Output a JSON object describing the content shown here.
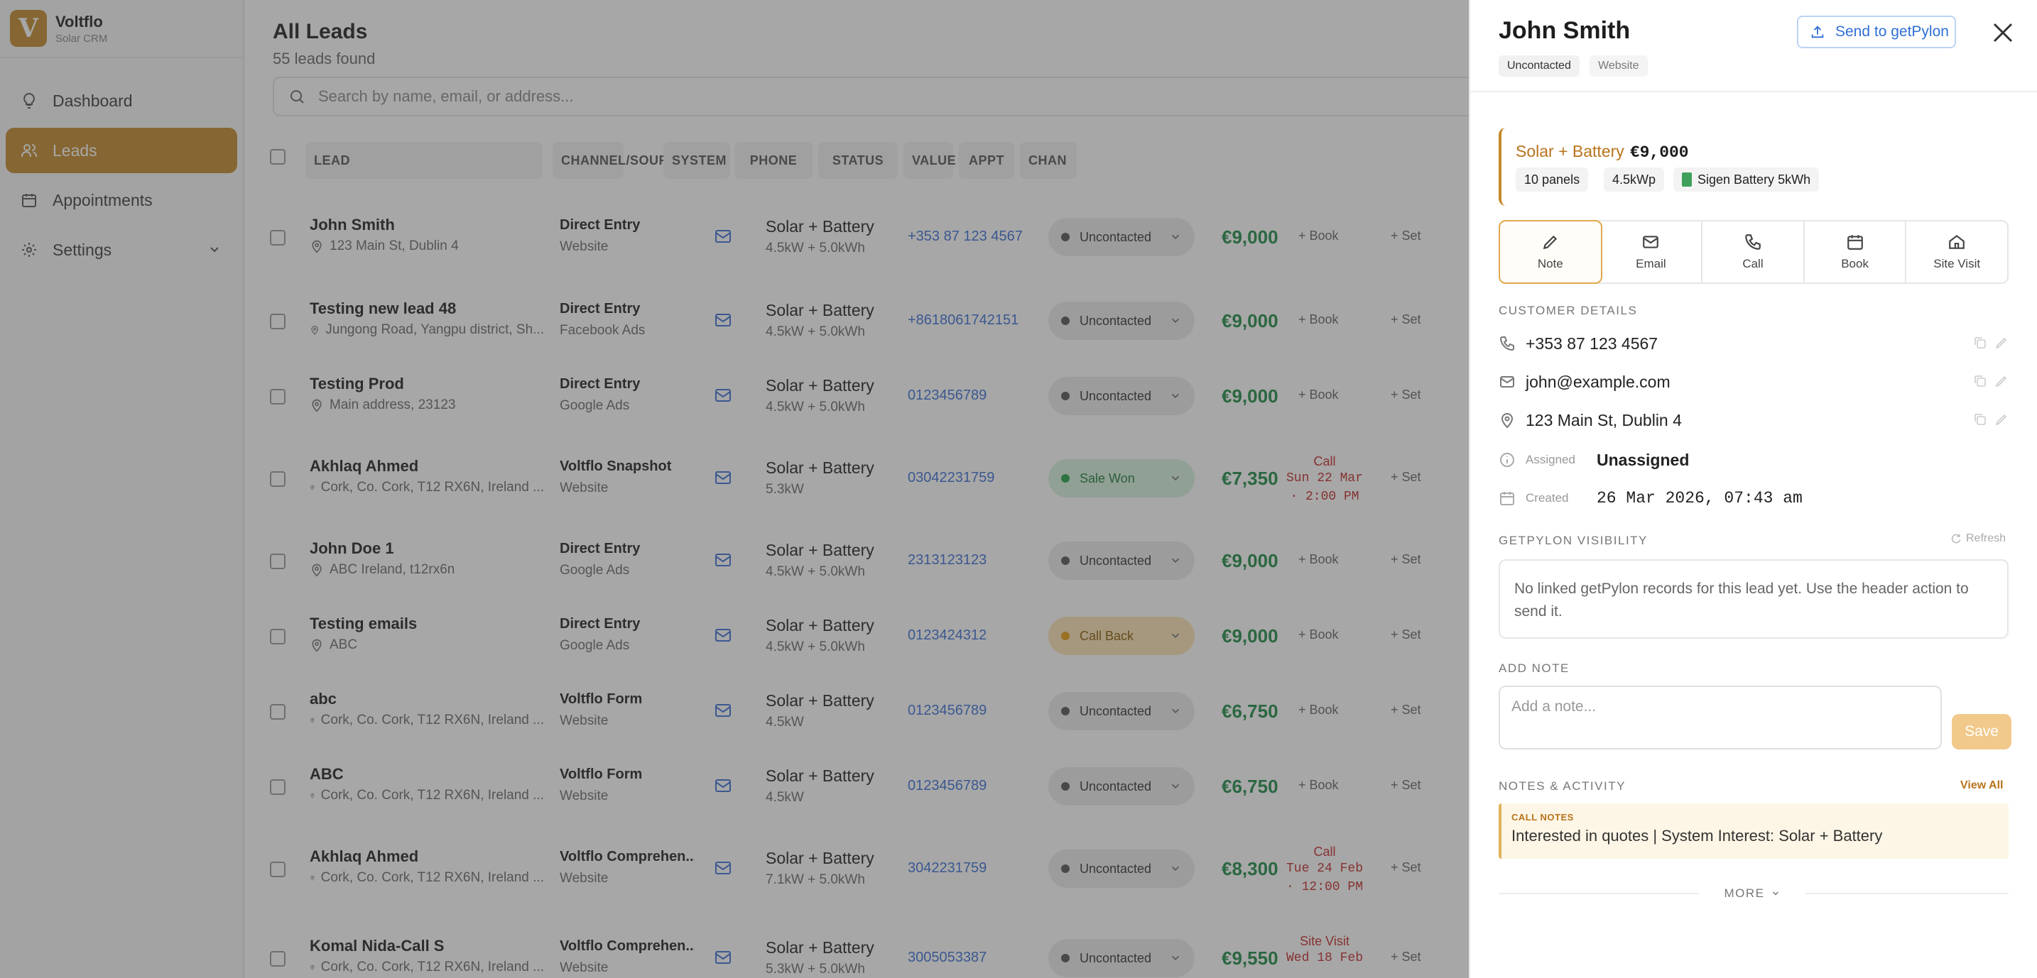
{
  "brand": {
    "logo_letter": "V",
    "name": "Voltflo",
    "subtitle": "Solar CRM",
    "accent": "#c4892b"
  },
  "nav": [
    {
      "label": "Dashboard",
      "icon": "lightbulb-icon",
      "active": false
    },
    {
      "label": "Leads",
      "icon": "users-icon",
      "active": true
    },
    {
      "label": "Appointments",
      "icon": "calendar-icon",
      "active": false
    },
    {
      "label": "Settings",
      "icon": "gear-icon",
      "active": false
    }
  ],
  "main": {
    "title": "All Leads",
    "count_text": "55 leads found",
    "search_placeholder": "Search by name, email, or address...",
    "columns": [
      "LEAD",
      "CHANNEL/SOURCE",
      "SYSTEM",
      "PHONE",
      "STATUS",
      "VALUE",
      "APPT",
      "CHAN"
    ],
    "book_label": "+ Book",
    "set_label": "+ Set"
  },
  "leads": [
    {
      "name": "John Smith",
      "address": "123 Main St, Dublin 4",
      "channel": "Direct Entry",
      "source": "Website",
      "system": "Solar + Battery",
      "system_spec": "4.5kW + 5.0kWh",
      "phone": "+353 87 123 4567",
      "status": "Uncontacted",
      "value": "€9,000",
      "appt": null
    },
    {
      "name": "Testing new lead 48",
      "address": "Jungong Road, Yangpu district, Sh...",
      "channel": "Direct Entry",
      "source": "Facebook Ads",
      "system": "Solar + Battery",
      "system_spec": "4.5kW + 5.0kWh",
      "phone": "+8618061742151",
      "status": "Uncontacted",
      "value": "€9,000",
      "appt": null
    },
    {
      "name": "Testing Prod",
      "address": "Main address, 23123",
      "channel": "Direct Entry",
      "source": "Google Ads",
      "system": "Solar + Battery",
      "system_spec": "4.5kW + 5.0kWh",
      "phone": "0123456789",
      "status": "Uncontacted",
      "value": "€9,000",
      "appt": null
    },
    {
      "name": "Akhlaq Ahmed",
      "address": "Cork, Co. Cork, T12 RX6N, Ireland ...",
      "channel": "Voltflo Snapshot",
      "source": "Website",
      "system": "Solar + Battery",
      "system_spec": "5.3kW",
      "phone": "03042231759",
      "status": "Sale Won",
      "value": "€7,350",
      "appt": {
        "type": "Call",
        "line1": "Sun 22 Mar",
        "line2": "· 2:00 PM"
      }
    },
    {
      "name": "John Doe 1",
      "address": "ABC Ireland, t12rx6n",
      "channel": "Direct Entry",
      "source": "Google Ads",
      "system": "Solar + Battery",
      "system_spec": "4.5kW + 5.0kWh",
      "phone": "2313123123",
      "status": "Uncontacted",
      "value": "€9,000",
      "appt": null
    },
    {
      "name": "Testing emails",
      "address": "ABC",
      "channel": "Direct Entry",
      "source": "Google Ads",
      "system": "Solar + Battery",
      "system_spec": "4.5kW + 5.0kWh",
      "phone": "0123424312",
      "status": "Call Back",
      "value": "€9,000",
      "appt": null
    },
    {
      "name": "abc",
      "address": "Cork, Co. Cork, T12 RX6N, Ireland ...",
      "channel": "Voltflo Form",
      "source": "Website",
      "system": "Solar + Battery",
      "system_spec": "4.5kW",
      "phone": "0123456789",
      "status": "Uncontacted",
      "value": "€6,750",
      "appt": null
    },
    {
      "name": "ABC",
      "address": "Cork, Co. Cork, T12 RX6N, Ireland ...",
      "channel": "Voltflo Form",
      "source": "Website",
      "system": "Solar + Battery",
      "system_spec": "4.5kW",
      "phone": "0123456789",
      "status": "Uncontacted",
      "value": "€6,750",
      "appt": null
    },
    {
      "name": "Akhlaq Ahmed",
      "address": "Cork, Co. Cork, T12 RX6N, Ireland ...",
      "channel": "Voltflo Comprehen...",
      "source": "Website",
      "system": "Solar + Battery",
      "system_spec": "7.1kW + 5.0kWh",
      "phone": "3042231759",
      "status": "Uncontacted",
      "value": "€8,300",
      "appt": {
        "type": "Call",
        "line1": "Tue 24 Feb",
        "line2": "· 12:00 PM"
      }
    },
    {
      "name": "Komal Nida-Call S",
      "address": "Cork, Co. Cork, T12 RX6N, Ireland ...",
      "channel": "Voltflo Comprehen...",
      "source": "Website",
      "system": "Solar + Battery",
      "system_spec": "5.3kW + 5.0kWh",
      "phone": "3005053387",
      "status": "Uncontacted",
      "value": "€9,550",
      "appt": {
        "type": "Site Visit",
        "line1": "Wed 18 Feb",
        "line2": ""
      }
    }
  ],
  "drawer": {
    "name": "John Smith",
    "tags": [
      "Uncontacted",
      "Website"
    ],
    "send_label": "Send to getPylon",
    "quote": {
      "title": "Solar + Battery",
      "price": "€9,000",
      "chips": [
        "10 panels",
        "4.5kWp",
        "Sigen Battery 5kWh"
      ]
    },
    "actions": [
      {
        "label": "Note",
        "icon": "pencil-icon"
      },
      {
        "label": "Email",
        "icon": "mail-icon"
      },
      {
        "label": "Call",
        "icon": "phone-icon"
      },
      {
        "label": "Book",
        "icon": "calendar-icon"
      },
      {
        "label": "Site Visit",
        "icon": "home-icon"
      }
    ],
    "customer_details_label": "CUSTOMER DETAILS",
    "phone": "+353 87 123 4567",
    "email": "john@example.com",
    "address": "123 Main St, Dublin 4",
    "assigned_label": "Assigned",
    "assigned_value": "Unassigned",
    "created_label": "Created",
    "created_value": "26 Mar 2026, 07:43 am",
    "visibility_label": "GETPYLON VISIBILITY",
    "refresh_label": "Refresh",
    "visibility_text": "No linked getPylon records for this lead yet. Use the header action to send it.",
    "add_note_label": "ADD NOTE",
    "note_placeholder": "Add a note...",
    "save_label": "Save",
    "notes_label": "NOTES & ACTIVITY",
    "view_all_label": "View All",
    "note_type": "CALL NOTES",
    "note_text": "Interested in quotes | System Interest: Solar + Battery",
    "more_label": "MORE"
  }
}
